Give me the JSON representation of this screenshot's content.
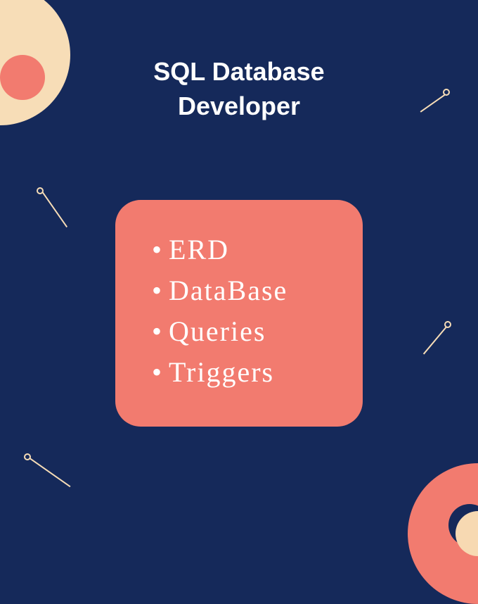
{
  "title_line1": "SQL Database",
  "title_line2": "Developer",
  "bullets": {
    "b0": "ERD",
    "b1": "DataBase",
    "b2": "Queries",
    "b3": "Triggers"
  },
  "colors": {
    "bg": "#15295a",
    "card": "#f27b6f",
    "accent_cream": "#f7ddb7",
    "text": "#ffffff"
  }
}
